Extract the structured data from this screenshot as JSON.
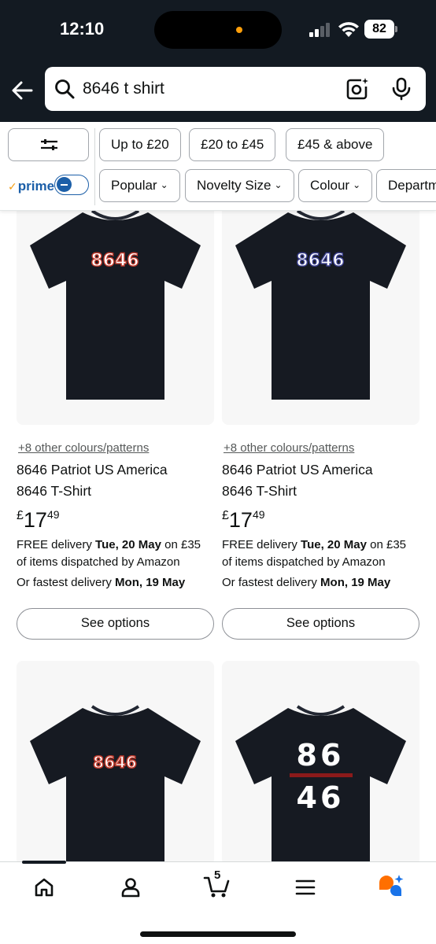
{
  "status": {
    "time": "12:10",
    "battery": "82"
  },
  "search": {
    "query": "8646 t shirt"
  },
  "filters": {
    "price_chips": [
      "Up to £20",
      "£20 to £45",
      "£45 & above"
    ],
    "dropdown_chips": [
      "Popular",
      "Novelty Size",
      "Colour",
      "Departm"
    ],
    "prime_label": "prime",
    "prime_enabled": false
  },
  "products": [
    {
      "print": "8646",
      "print_color": "#c0392b",
      "colours_link": "+8 other colours/patterns",
      "title_line1": "8646 Patriot US America",
      "title_line2": "8646 T-Shirt",
      "price_currency": "£",
      "price_whole": "17",
      "price_fraction": "49",
      "delivery_prefix": "FREE delivery ",
      "delivery_date": "Tue, 20 May",
      "delivery_suffix": " on £35",
      "delivery_line2": "of items dispatched by Amazon",
      "fastest_prefix": "Or fastest delivery ",
      "fastest_date": "Mon, 19 May",
      "button_label": "See options"
    },
    {
      "print": "8646",
      "print_color": "#3a3f8f",
      "colours_link": "+8 other colours/patterns",
      "title_line1": "8646 Patriot US America",
      "title_line2": "8646 T-Shirt",
      "price_currency": "£",
      "price_whole": "17",
      "price_fraction": "49",
      "delivery_prefix": "FREE delivery ",
      "delivery_date": "Tue, 20 May",
      "delivery_suffix": " on £35",
      "delivery_line2": "of items dispatched by Amazon",
      "fastest_prefix": "Or fastest delivery ",
      "fastest_date": "Mon, 19 May",
      "button_label": "See options"
    },
    {
      "print": "8646",
      "print_color": "#c0392b"
    },
    {
      "print_top": "86",
      "print_bottom": "46",
      "print_color": "#ffffff",
      "bar_color": "#8b1a1a"
    }
  ],
  "bottom_nav": {
    "items": [
      "home-icon",
      "account-icon",
      "cart-icon",
      "menu-icon",
      "rufus-ai-icon"
    ],
    "cart_count": "5"
  },
  "colors": {
    "header_bg": "#131a22",
    "prime_blue": "#1c5fa8",
    "ai_orange": "#ff6f00",
    "ai_blue": "#1a73e8"
  }
}
